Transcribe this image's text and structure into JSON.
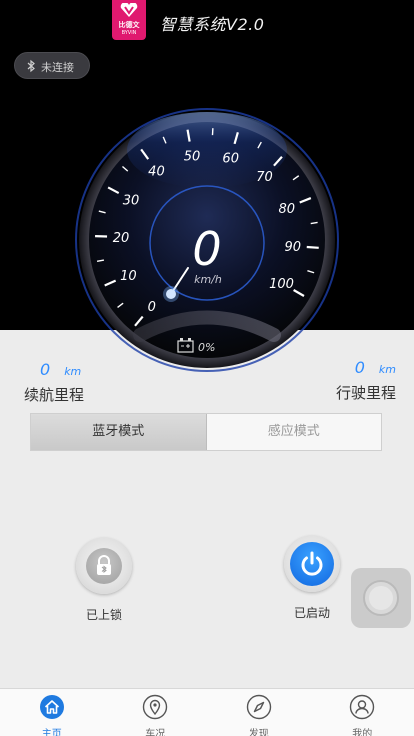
{
  "app": {
    "brand_cn": "比德文",
    "brand_en": "BYVIN",
    "title": "智慧系统V2.0",
    "brand_color": "#e0196f"
  },
  "bluetooth": {
    "status_label": "未连接",
    "icon": "bluetooth-icon"
  },
  "gauge": {
    "speed": "0",
    "unit": "km/h",
    "min": 0,
    "max": 100,
    "ticks": [
      "0",
      "10",
      "20",
      "30",
      "40",
      "50",
      "60",
      "70",
      "80",
      "90",
      "100"
    ],
    "battery_label": "0%",
    "battery_icon": "battery-icon",
    "accent_color": "#2f7cff"
  },
  "stats": {
    "range": {
      "value": "0",
      "unit": "km",
      "label": "续航里程"
    },
    "odometer": {
      "value": "0",
      "unit": "km",
      "label": "行驶里程"
    }
  },
  "mode_tabs": [
    {
      "label": "蓝牙模式",
      "active": true
    },
    {
      "label": "感应模式",
      "active": false
    }
  ],
  "controls": {
    "lock": {
      "label": "已上锁",
      "icon": "lock-icon"
    },
    "power": {
      "label": "已启动",
      "icon": "power-icon",
      "color": "#1f7ae0"
    }
  },
  "bottom_nav": [
    {
      "label": "主页",
      "icon": "home-icon",
      "active": true
    },
    {
      "label": "车况",
      "icon": "location-pin-icon",
      "active": false
    },
    {
      "label": "发现",
      "icon": "compass-icon",
      "active": false
    },
    {
      "label": "我的",
      "icon": "user-icon",
      "active": false
    }
  ]
}
